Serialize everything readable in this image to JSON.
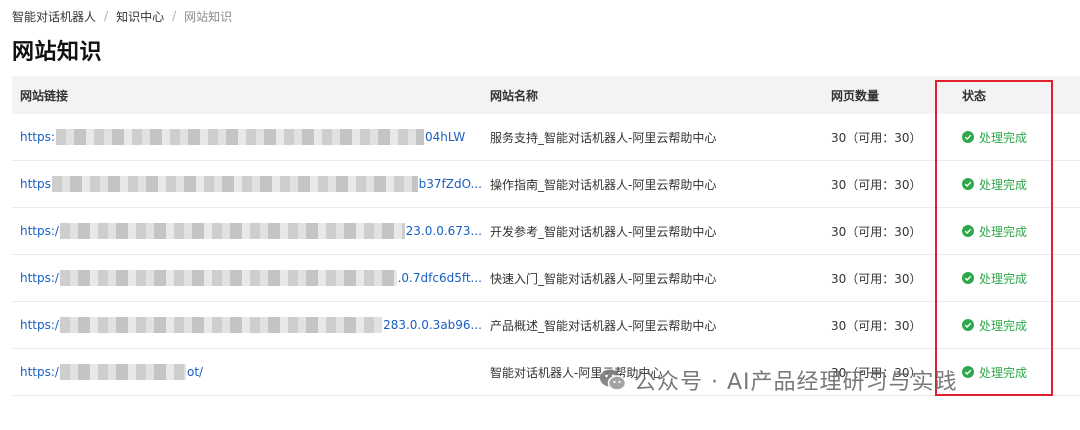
{
  "breadcrumb": {
    "items": [
      "智能对话机器人",
      "知识中心",
      "网站知识"
    ],
    "separator": "/"
  },
  "page_title": "网站知识",
  "table": {
    "headers": {
      "url": "网站链接",
      "name": "网站名称",
      "count": "网页数量",
      "status": "状态"
    },
    "rows": [
      {
        "url_prefix": "https:",
        "url_suffix": "04hLW",
        "name": "服务支持_智能对话机器人-阿里云帮助中心",
        "count": "30（可用：30）",
        "status": "处理完成"
      },
      {
        "url_prefix": "https",
        "url_suffix": "b37fZdO...",
        "name": "操作指南_智能对话机器人-阿里云帮助中心",
        "count": "30（可用：30）",
        "status": "处理完成"
      },
      {
        "url_prefix": "https:/",
        "url_suffix": "23.0.0.673...",
        "name": "开发参考_智能对话机器人-阿里云帮助中心",
        "count": "30（可用：30）",
        "status": "处理完成"
      },
      {
        "url_prefix": "https:/",
        "url_suffix": ".0.7dfc6d5ft...",
        "name": "快速入门_智能对话机器人-阿里云帮助中心",
        "count": "30（可用：30）",
        "status": "处理完成"
      },
      {
        "url_prefix": "https:/",
        "url_suffix": "283.0.0.3ab96...",
        "name": "产品概述_智能对话机器人-阿里云帮助中心",
        "count": "30（可用：30）",
        "status": "处理完成"
      },
      {
        "url_prefix": "https:/",
        "url_suffix": "ot/",
        "name": "智能对话机器人-阿里云帮助中心",
        "count": "30（可用：30）",
        "status": "处理完成"
      }
    ]
  },
  "watermark": {
    "text": "公众号 · AI产品经理研习与实践",
    "icon": "wechat-icon"
  },
  "colors": {
    "link": "#1a5fc1",
    "status_success": "#2ea84a",
    "highlight": "#e0202e",
    "header_bg": "#f3f3f3"
  }
}
